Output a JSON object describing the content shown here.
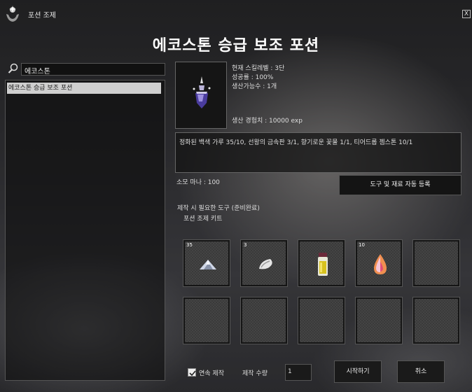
{
  "window": {
    "title": "포션 조제",
    "close_label": "X",
    "main_title": "에코스톤 승급 보조 포션"
  },
  "search": {
    "value": "에코스톤"
  },
  "recipe_list": {
    "items": [
      {
        "label": "에코스톤 승급 보조 포션",
        "selected": true
      }
    ]
  },
  "item_info": {
    "image_icon": "crystal-potion-icon",
    "skill_level": "현재 스킬레벨 : 3단",
    "success_rate": "성공률 : 100%",
    "producible_count": "생산가능수 : 1개",
    "exp": "생산 경험치 : 10000 exp"
  },
  "materials": {
    "description": "정화된 백색 가루 35/10, 선왕의 금속판 3/1, 향기로운 꽃물 1/1, 티어드롭 젬스톤 10/1"
  },
  "mana": "소모 마나 : 100",
  "buttons": {
    "auto_register": "도구 및 재료 자동 등록",
    "start": "시작하기",
    "cancel": "취소"
  },
  "tools": {
    "label": "제작 시 필요한 도구 (준비완료)",
    "items": [
      "포션 조제 키트"
    ]
  },
  "slots": [
    {
      "count": "35",
      "icon": "white-powder-icon"
    },
    {
      "count": "3",
      "icon": "metal-plate-icon"
    },
    {
      "count": "",
      "icon": "flower-water-bottle-icon"
    },
    {
      "count": "10",
      "icon": "teardrop-gemstone-icon"
    },
    {
      "count": "",
      "icon": ""
    },
    {
      "count": "",
      "icon": ""
    },
    {
      "count": "",
      "icon": ""
    },
    {
      "count": "",
      "icon": ""
    },
    {
      "count": "",
      "icon": ""
    },
    {
      "count": "",
      "icon": ""
    }
  ],
  "footer": {
    "continuous_label": "연속 제작",
    "continuous_checked": true,
    "quantity_label": "제작 수량",
    "quantity_value": "1"
  },
  "colors": {
    "selected_item_bg": "#cfcfcf",
    "panel_border": "#555555"
  }
}
